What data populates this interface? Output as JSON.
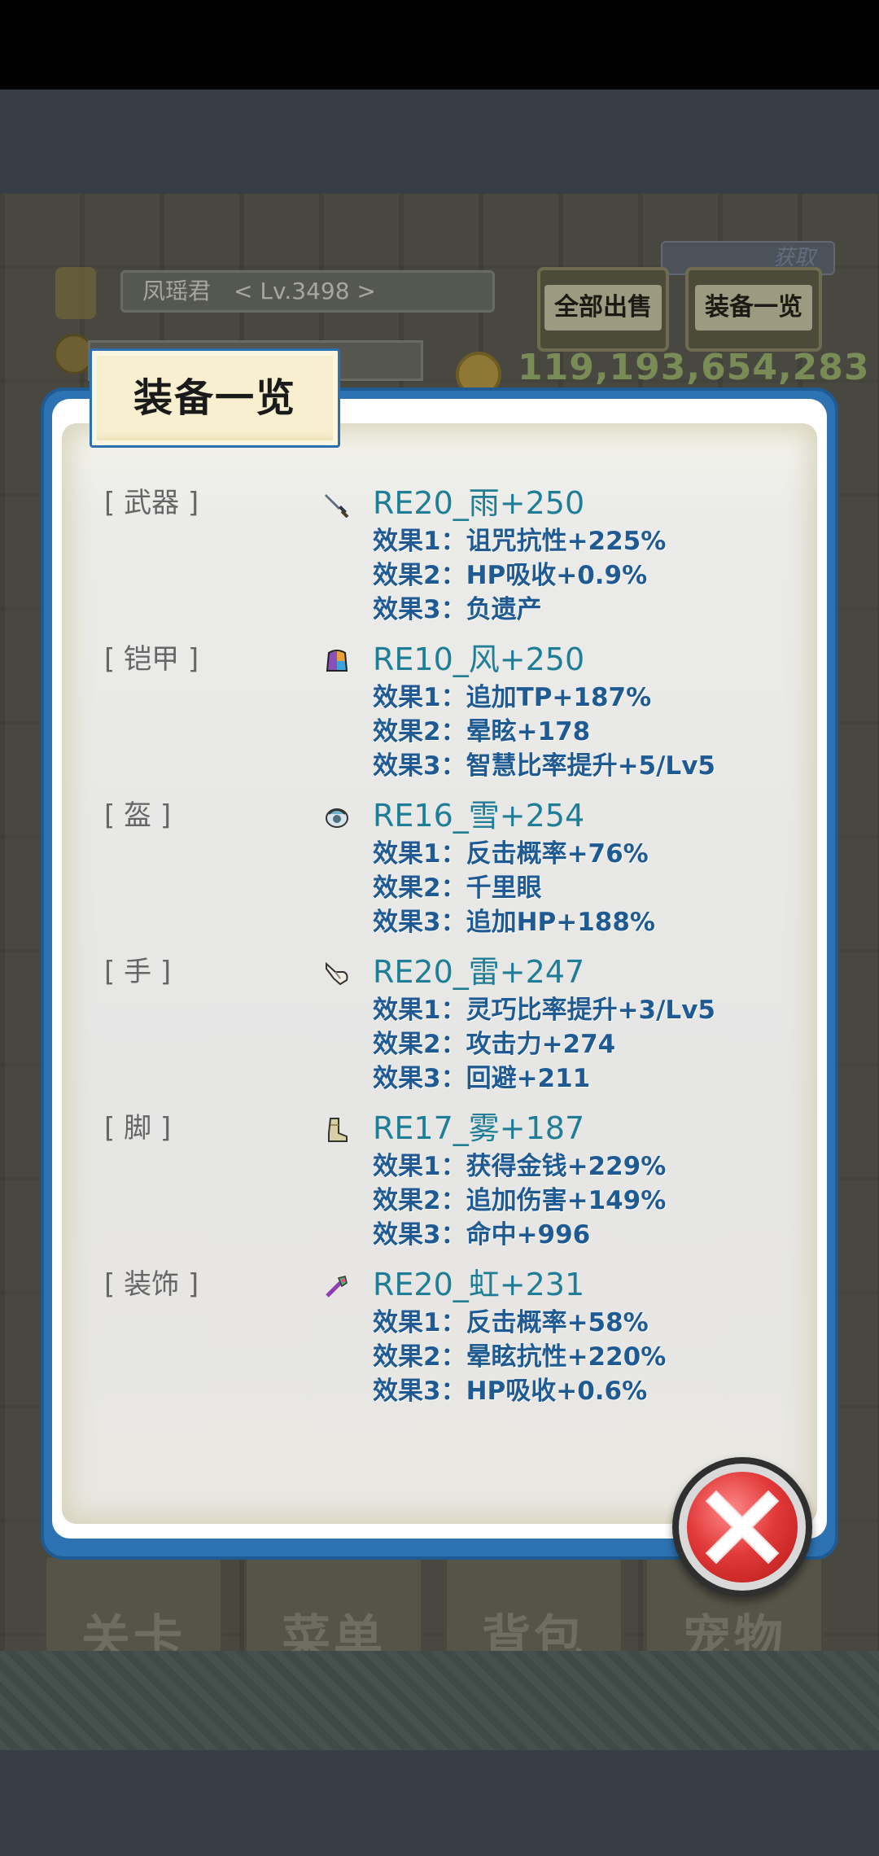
{
  "player": {
    "name": "凤瑶君",
    "level": "< Lv.3498 >",
    "gold_ghost": "119,193,654,283"
  },
  "header": {
    "top_ribbon": "获取",
    "sell_all_label": "全部出售",
    "overview_label": "装备一览",
    "gold": "119,193,654,283"
  },
  "bottom_nav": [
    "关卡",
    "菜单",
    "背包",
    "宠物"
  ],
  "dialog": {
    "title": "装备一览",
    "slots": [
      {
        "label": "[ 武器 ]",
        "icon": "sword-icon",
        "item": "RE20_雨+250",
        "effects": [
          "效果1：诅咒抗性+225%",
          "效果2：HP吸收+0.9%",
          "效果3：负遗产"
        ]
      },
      {
        "label": "[ 铠甲 ]",
        "icon": "armor-icon",
        "item": "RE10_风+250",
        "effects": [
          "效果1：追加TP+187%",
          "效果2：晕眩+178",
          "效果3：智慧比率提升+5/Lv5"
        ]
      },
      {
        "label": "[ 盔 ]",
        "icon": "helmet-icon",
        "item": "RE16_雪+254",
        "effects": [
          "效果1：反击概率+76%",
          "效果2：千里眼",
          "效果3：追加HP+188%"
        ]
      },
      {
        "label": "[ 手 ]",
        "icon": "glove-icon",
        "item": "RE20_雷+247",
        "effects": [
          "效果1：灵巧比率提升+3/Lv5",
          "效果2：攻击力+274",
          "效果3：回避+211"
        ]
      },
      {
        "label": "[ 脚 ]",
        "icon": "boot-icon",
        "item": "RE17_雾+187",
        "effects": [
          "效果1：获得金钱+229%",
          "效果2：追加伤害+149%",
          "效果3：命中+996"
        ]
      },
      {
        "label": "[ 装饰 ]",
        "icon": "accessory-icon",
        "item": "RE20_虹+231",
        "effects": [
          "效果1：反击概率+58%",
          "效果2：晕眩抗性+220%",
          "效果3：HP吸收+0.6%"
        ]
      }
    ]
  },
  "colors": {
    "dialog_frame": "#2d73b3",
    "item_name": "#1f7e95",
    "effect_text": "#1f5b92",
    "close_button": "#e23a3a"
  }
}
